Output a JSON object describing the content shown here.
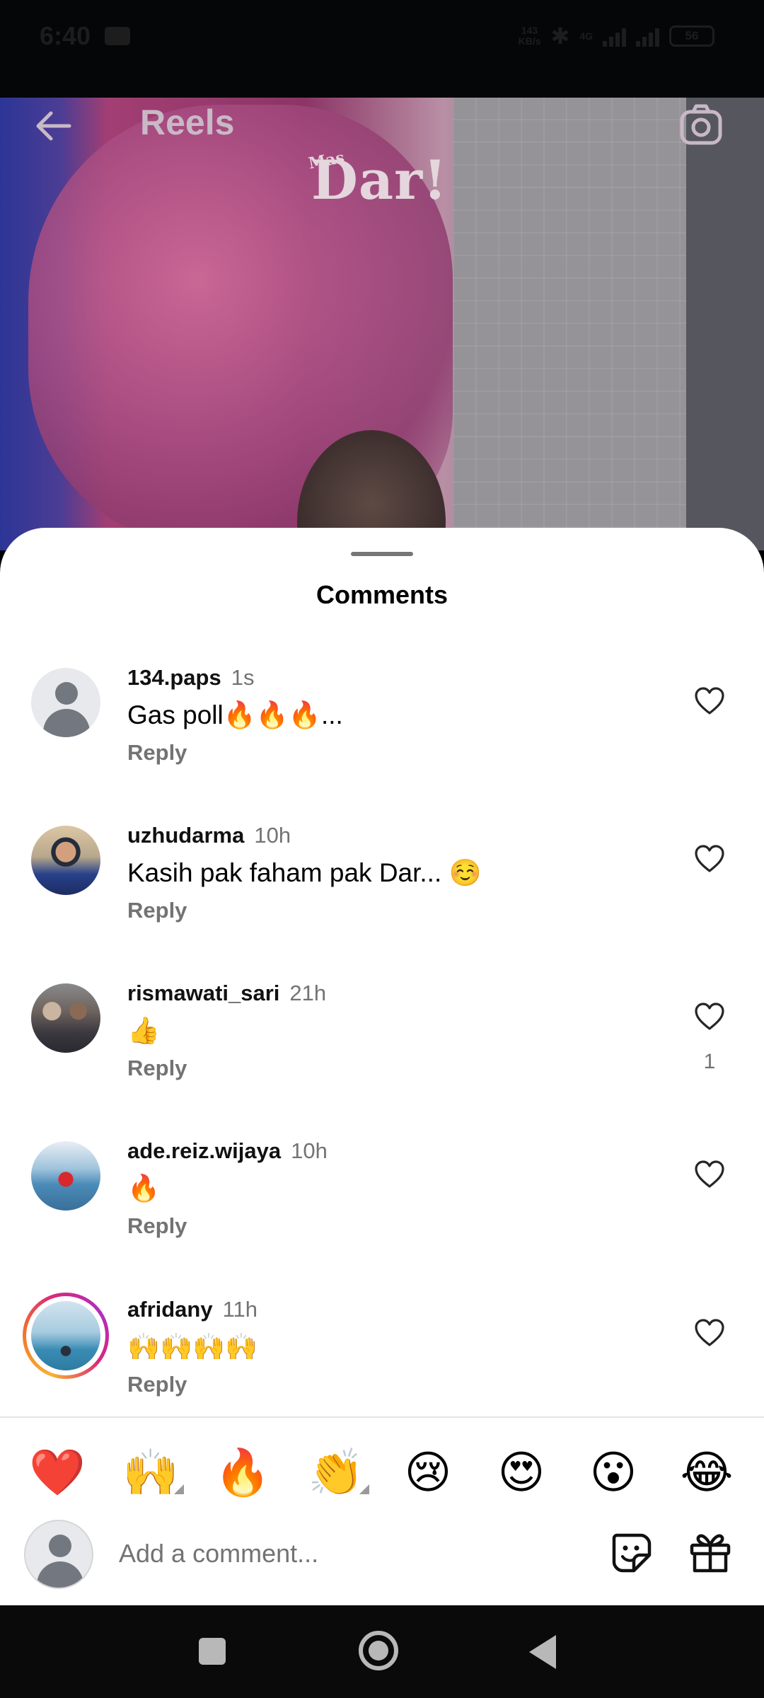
{
  "status_bar": {
    "time": "6:40",
    "net_speed_value": "143",
    "net_speed_unit": "KB/s",
    "network_type": "4G",
    "battery": "56"
  },
  "reels_header": {
    "title": "Reels",
    "video_logo": "Dar!",
    "video_logo_small": "Mas"
  },
  "comments_sheet": {
    "title": "Comments",
    "reply_label": "Reply",
    "comments": [
      {
        "username": "134.paps",
        "time": "1s",
        "text": "Gas poll🔥🔥🔥...",
        "likes": "",
        "avatar": "default"
      },
      {
        "username": "uzhudarma",
        "time": "10h",
        "text": "Kasih pak faham pak Dar... ☺️",
        "likes": "",
        "avatar": "photo"
      },
      {
        "username": "rismawati_sari",
        "time": "21h",
        "text": "👍",
        "likes": "1",
        "avatar": "photo"
      },
      {
        "username": "ade.reiz.wijaya",
        "time": "10h",
        "text": "🔥",
        "likes": "",
        "avatar": "photo"
      },
      {
        "username": "afridany",
        "time": "11h",
        "text": "🙌🙌🙌🙌",
        "likes": "",
        "avatar": "story-ring"
      }
    ]
  },
  "emoji_bar": [
    "❤️",
    "🙌",
    "🔥",
    "👏",
    "😢",
    "😍",
    "😮",
    "😂"
  ],
  "compose": {
    "placeholder": "Add a comment..."
  },
  "colors": {
    "sheet_bg": "#ffffff",
    "secondary_text": "#737373",
    "story_ring": "#d9277c"
  }
}
